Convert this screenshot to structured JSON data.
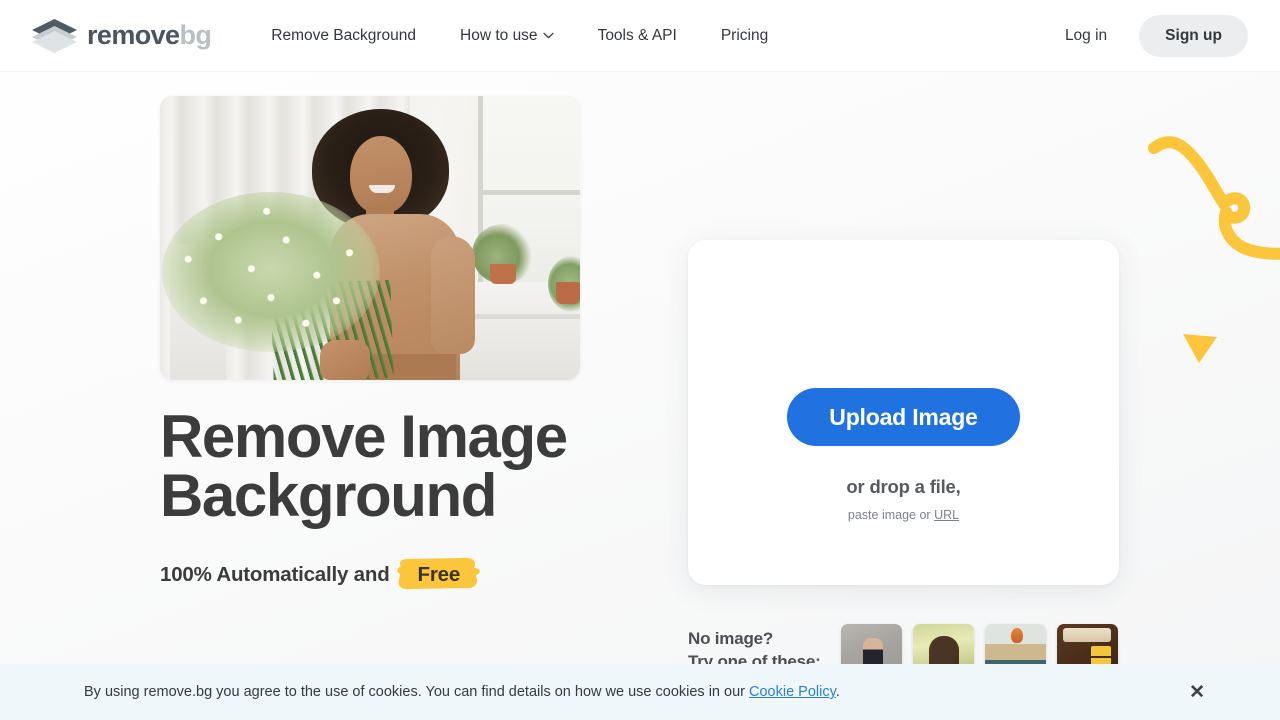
{
  "header": {
    "logo": {
      "name_dark": "remove",
      "name_light": "bg",
      "icon": "stacked-diamond-logo"
    },
    "nav": [
      {
        "label": "Remove Background",
        "has_chevron": false
      },
      {
        "label": "How to use",
        "has_chevron": true
      },
      {
        "label": "Tools & API",
        "has_chevron": false
      },
      {
        "label": "Pricing",
        "has_chevron": false
      }
    ],
    "login_label": "Log in",
    "signup_label": "Sign up"
  },
  "hero": {
    "photo_alt": "woman holding bouquet of white daisies in bright room",
    "title_line1": "Remove Image",
    "title_line2": "Background",
    "subtitle_prefix": "100% Automatically and",
    "subtitle_highlight": "Free"
  },
  "upload": {
    "button_label": "Upload Image",
    "drop_text": "or drop a file,",
    "paste_prefix": "paste image or",
    "paste_link": "URL"
  },
  "samples": {
    "prompt_line1": "No image?",
    "prompt_line2": "Try one of these:",
    "thumbnails": [
      {
        "alt": "woman flexing arm"
      },
      {
        "alt": "dog carrying stick"
      },
      {
        "alt": "car with hot air balloon"
      },
      {
        "alt": "paint roller on wood"
      }
    ]
  },
  "cookie": {
    "text": "By using remove.bg you agree to the use of cookies. You can find details on how we use cookies in our",
    "link_label": "Cookie Policy",
    "trailing": ".",
    "close_label": "✕"
  },
  "decor": {
    "squiggle": "yellow-squiggle-line",
    "triangle": "yellow-down-triangle"
  },
  "colors": {
    "accent_blue": "#1f72e0",
    "highlight_yellow": "#fbc53c",
    "heading": "#3c3c3c",
    "cookie_bg": "#eff7fb",
    "link_blue": "#2a7fd4"
  }
}
